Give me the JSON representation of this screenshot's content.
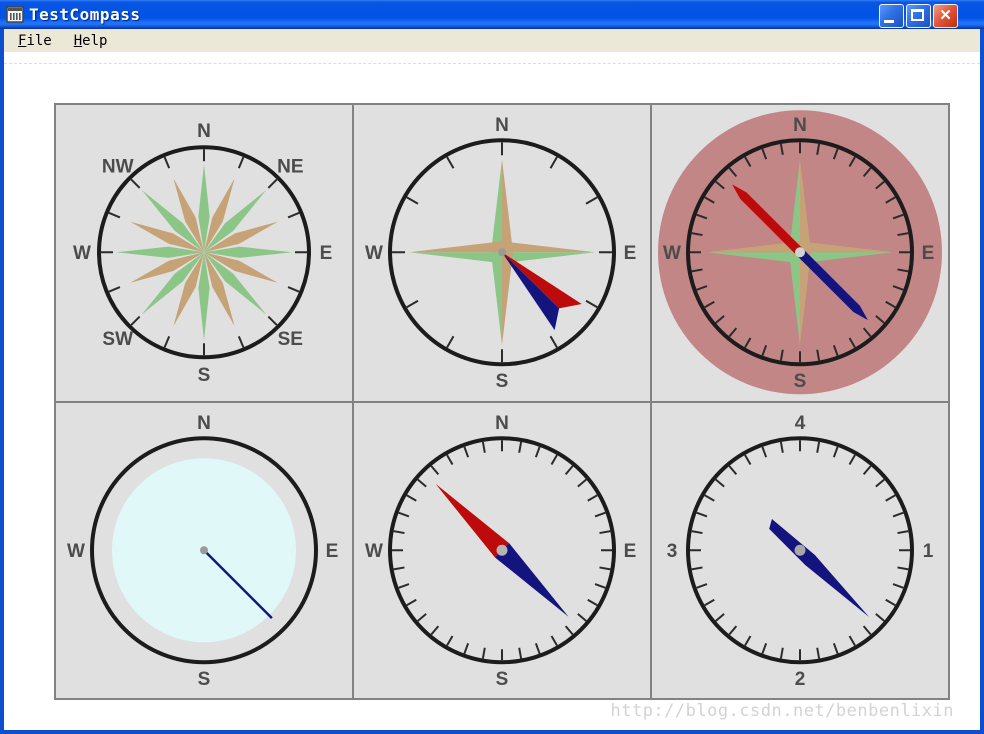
{
  "window": {
    "title": "TestCompass",
    "close_glyph": "✕"
  },
  "menu": {
    "items": [
      {
        "label": "File",
        "first": "F",
        "rest": "ile"
      },
      {
        "label": "Help",
        "first": "H",
        "rest": "elp"
      }
    ]
  },
  "watermark": {
    "text": "http://blog.csdn.net/benbenlixin"
  },
  "colors": {
    "rose_green": "#8bc687",
    "rose_tan": "#c5a377",
    "needle_red": "#bd0b0b",
    "needle_navy": "#14147e",
    "dial_pink": "#c28686",
    "dial_cyan": "#e1f8f8",
    "ring": "#1c1c1c",
    "tick": "#2b2b2b",
    "label": "#4c4c4c",
    "panel_bg": "#e0e0e0",
    "grid_line": "#828282",
    "title_blue": "#0353e6"
  },
  "compasses": [
    {
      "name": "rose-16-point",
      "labels": [
        {
          "text": "N",
          "bearing": 0
        },
        {
          "text": "NE",
          "bearing": 45
        },
        {
          "text": "E",
          "bearing": 90
        },
        {
          "text": "SE",
          "bearing": 135
        },
        {
          "text": "S",
          "bearing": 180
        },
        {
          "text": "SW",
          "bearing": 225
        },
        {
          "text": "W",
          "bearing": 270
        },
        {
          "text": "NW",
          "bearing": 315
        }
      ],
      "ring_radius": 105,
      "label_radius": 122,
      "ticks": {
        "step_deg": 22.5,
        "length": 12
      },
      "rose16": {
        "green_length": 88,
        "tan_length": 80,
        "base_radius": 36,
        "base_half_angle_deg": 9
      }
    },
    {
      "name": "star4-dart-needle",
      "labels": [
        {
          "text": "N",
          "bearing": 0
        },
        {
          "text": "E",
          "bearing": 90
        },
        {
          "text": "S",
          "bearing": 180
        },
        {
          "text": "W",
          "bearing": 270
        }
      ],
      "ring_radius": 112,
      "label_radius": 128,
      "ticks": {
        "step_deg": 30,
        "length": 13
      },
      "star4": {
        "length": 93,
        "half_width": 11
      },
      "needle": {
        "type": "dart",
        "red": [
          123,
          95
        ],
        "mid": [
          134.5,
          80
        ],
        "blue": [
          146,
          94
        ]
      },
      "center_dot": {
        "color": "#9a9a9a",
        "radius": 4
      }
    },
    {
      "name": "pink-dial",
      "labels": [
        {
          "text": "N",
          "bearing": 0
        },
        {
          "text": "E",
          "bearing": 90
        },
        {
          "text": "S",
          "bearing": 180
        },
        {
          "text": "W",
          "bearing": 270
        }
      ],
      "ring_radius": 112,
      "label_radius": 128,
      "disc": {
        "color_key": "dial_pink",
        "radius": 142
      },
      "ticks": {
        "step_deg": 10,
        "length": 11
      },
      "star4": {
        "length": 93,
        "half_width": 11
      },
      "needle": {
        "type": "pencil-pair",
        "red_bearing": 315,
        "blue_bearing": 135,
        "length": 96,
        "half_width": 4.5,
        "taper": 16
      },
      "center_dot": {
        "color": "#d2d2d2",
        "radius": 5
      }
    },
    {
      "name": "cyan-dial",
      "labels": [
        {
          "text": "N",
          "bearing": 0
        },
        {
          "text": "E",
          "bearing": 90
        },
        {
          "text": "S",
          "bearing": 180
        },
        {
          "text": "W",
          "bearing": 270
        }
      ],
      "ring_radius": 112,
      "label_radius": 128,
      "disc": {
        "color_key": "dial_cyan",
        "radius": 92
      },
      "needle": {
        "type": "line",
        "bearing": 135,
        "length": 96,
        "width": 2.5
      },
      "center_dot": {
        "color": "#9a9a9a",
        "radius": 4
      }
    },
    {
      "name": "red-blue-kite-needle",
      "labels": [
        {
          "text": "N",
          "bearing": 0
        },
        {
          "text": "E",
          "bearing": 90
        },
        {
          "text": "S",
          "bearing": 180
        },
        {
          "text": "W",
          "bearing": 270
        }
      ],
      "ring_radius": 112,
      "label_radius": 128,
      "ticks": {
        "step_deg": 10,
        "length": 11
      },
      "needle": {
        "type": "kite-pair",
        "red_bearing": 315,
        "blue_bearing": 135,
        "length": 94,
        "half_width": 10
      },
      "center_dot": {
        "color": "#b4b4b4",
        "radius": 5.5
      }
    },
    {
      "name": "numeric-dial",
      "labels": [
        {
          "text": "4",
          "bearing": 0
        },
        {
          "text": "1",
          "bearing": 90
        },
        {
          "text": "2",
          "bearing": 180
        },
        {
          "text": "3",
          "bearing": 270
        }
      ],
      "ring_radius": 112,
      "label_radius": 128,
      "ticks": {
        "step_deg": 10,
        "length": 11
      },
      "needle": {
        "type": "sword",
        "bearing": 134,
        "tip_length": 96,
        "tail_length": 42,
        "half_width": 7
      },
      "center_dot": {
        "color": "#a8a8a8",
        "radius": 5.5
      }
    }
  ]
}
